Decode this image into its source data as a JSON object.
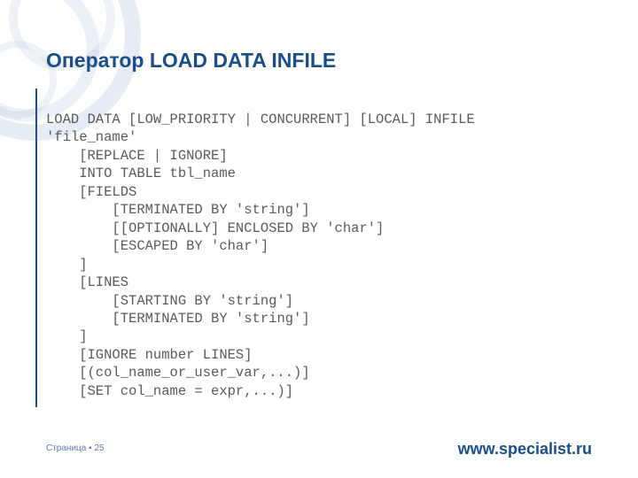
{
  "title": "Оператор LOAD DATA INFILE",
  "code": "LOAD DATA [LOW_PRIORITY | CONCURRENT] [LOCAL] INFILE\n'file_name'\n    [REPLACE | IGNORE]\n    INTO TABLE tbl_name\n    [FIELDS\n        [TERMINATED BY 'string']\n        [[OPTIONALLY] ENCLOSED BY 'char']\n        [ESCAPED BY 'char']\n    ]\n    [LINES\n        [STARTING BY 'string']\n        [TERMINATED BY 'string']\n    ]\n    [IGNORE number LINES]\n    [(col_name_or_user_var,...)]\n    [SET col_name = expr,...)]",
  "footer": {
    "page_label": "Страница ▪ 25",
    "site": "www.specialist.ru"
  },
  "colors": {
    "accent": "#1a4e8a",
    "body_text": "#5a5a5a"
  }
}
